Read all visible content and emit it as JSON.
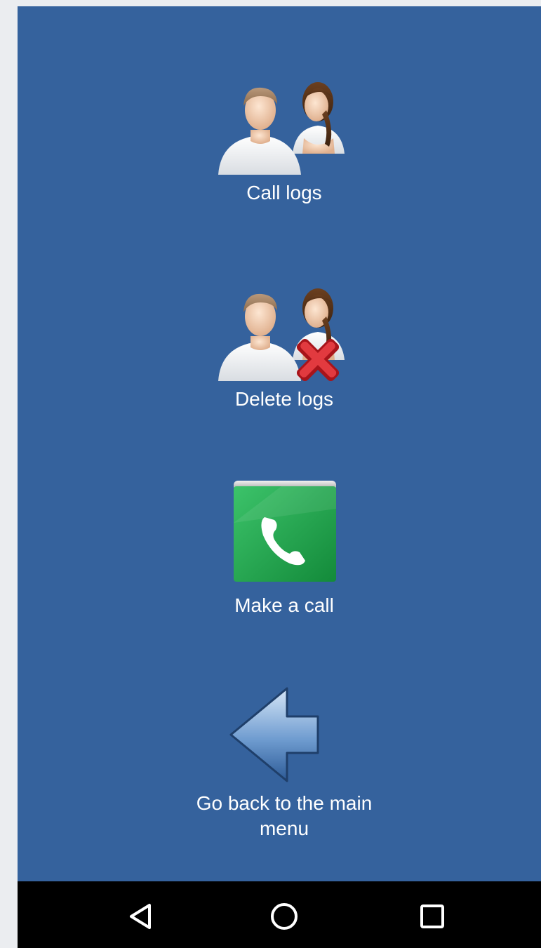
{
  "menu": {
    "items": [
      {
        "label": "Call logs",
        "icon": "people-icon"
      },
      {
        "label": "Delete logs",
        "icon": "delete-people-icon"
      },
      {
        "label": "Make a call",
        "icon": "phone-icon"
      },
      {
        "label": "Go back to the main menu",
        "icon": "back-arrow-icon"
      }
    ]
  },
  "navbar": {
    "buttons": [
      "back-triangle-icon",
      "home-circle-icon",
      "recents-square-icon"
    ]
  },
  "colors": {
    "background": "#35629d",
    "navbar": "#000000",
    "label": "#ffffff"
  }
}
